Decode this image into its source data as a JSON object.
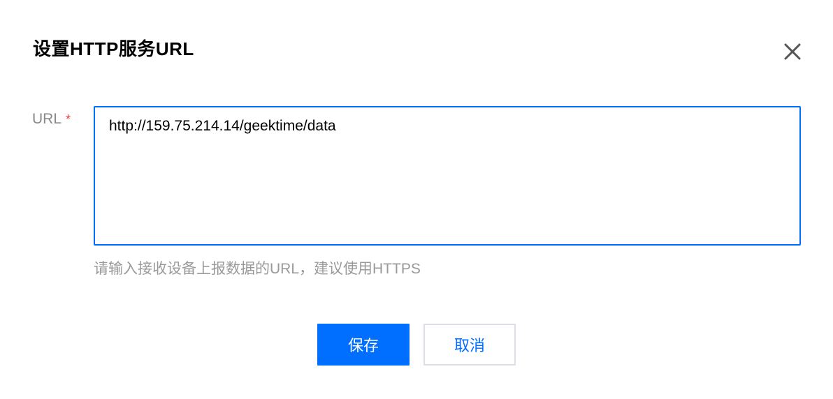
{
  "dialog": {
    "title": "设置HTTP服务URL",
    "close_icon": "close-icon"
  },
  "form": {
    "url_label": "URL",
    "required_mark": "*",
    "url_value": "http://159.75.214.14/geektime/data",
    "hint": "请输入接收设备上报数据的URL，建议使用HTTPS"
  },
  "buttons": {
    "save_label": "保存",
    "cancel_label": "取消"
  },
  "colors": {
    "accent": "#006eff",
    "required": "#e54545",
    "label": "#888888",
    "hint": "#999999"
  }
}
